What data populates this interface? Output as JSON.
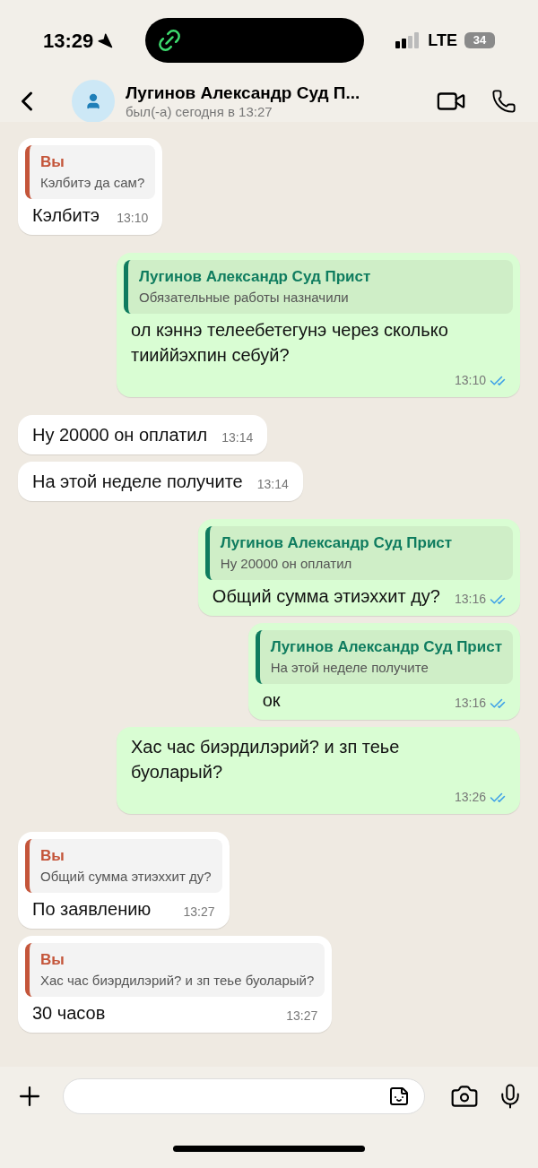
{
  "status_bar": {
    "time": "13:29",
    "network": "LTE",
    "battery": "34"
  },
  "header": {
    "name": "Лугинов Александр Суд П...",
    "status": "был(-а) сегодня в 13:27"
  },
  "messages": [
    {
      "kind": "incoming",
      "quote": {
        "author": "Вы",
        "text": "Кэлбитэ да сам?",
        "color": "#c4553a"
      },
      "text": "Кэлбитэ",
      "time": "13:10"
    },
    {
      "kind": "outgoing",
      "quote": {
        "author": "Лугинов Александр Суд Прист",
        "text": "Обязательные работы назначили",
        "color": "#0f7c5f"
      },
      "text": "ол кэннэ телеебетегунэ через сколько тииййэхпин себуй?",
      "time": "13:10",
      "read": true
    },
    {
      "kind": "incoming",
      "text": "Ну 20000 он оплатил",
      "time": "13:14"
    },
    {
      "kind": "incoming",
      "text": "На этой неделе получите",
      "time": "13:14"
    },
    {
      "kind": "outgoing",
      "quote": {
        "author": "Лугинов Александр Суд Прист",
        "text": "Ну 20000 он оплатил",
        "color": "#0f7c5f"
      },
      "text": "Общий сумма этиэххит ду?",
      "time": "13:16",
      "read": true
    },
    {
      "kind": "outgoing",
      "quote": {
        "author": "Лугинов Александр Суд Прист",
        "text": "На этой неделе получите",
        "color": "#0f7c5f"
      },
      "text": "ок",
      "time": "13:16",
      "read": true
    },
    {
      "kind": "outgoing",
      "text": "Хас час биэрдилэрий? и зп теье буоларый?",
      "time": "13:26",
      "read": true
    },
    {
      "kind": "incoming",
      "quote": {
        "author": "Вы",
        "text": "Общий сумма этиэххит ду?",
        "color": "#c4553a"
      },
      "text": "По заявлению",
      "time": "13:27"
    },
    {
      "kind": "incoming",
      "quote": {
        "author": "Вы",
        "text": "Хас час биэрдилэрий? и зп теье буоларый?",
        "color": "#c4553a"
      },
      "text": "30 часов",
      "time": "13:27"
    }
  ]
}
